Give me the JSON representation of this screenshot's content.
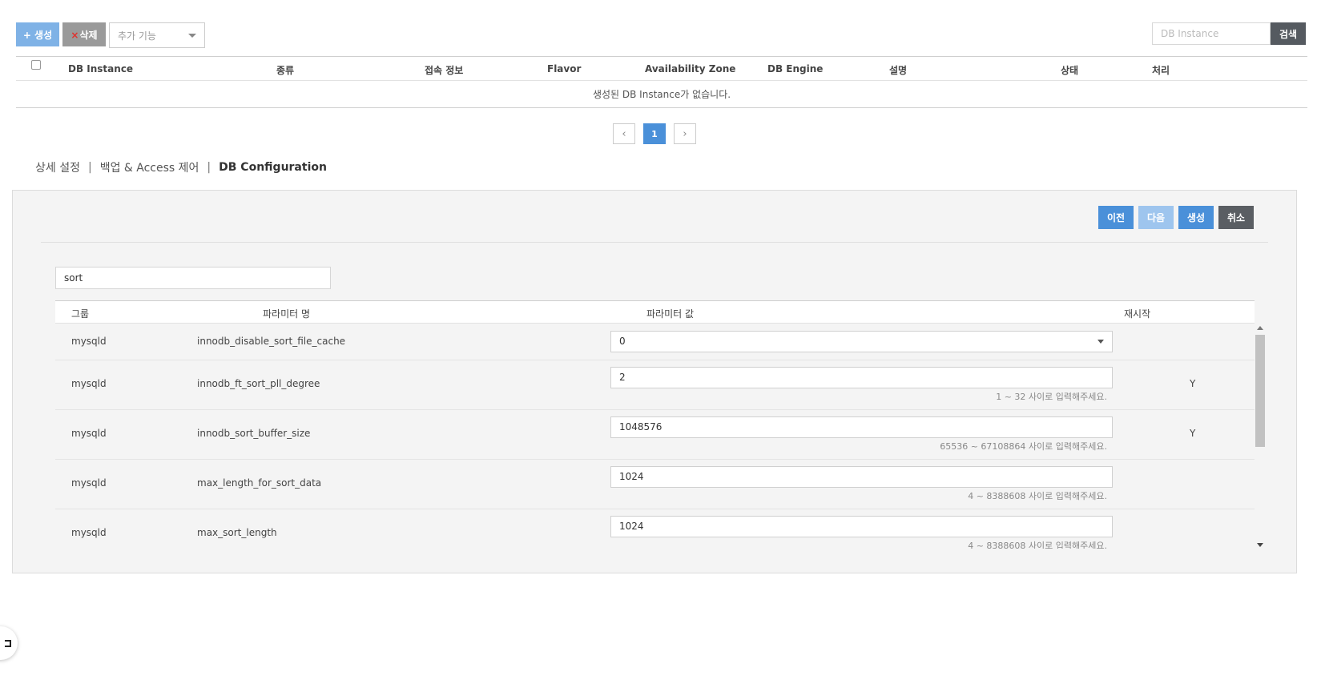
{
  "toolbar": {
    "create_label": "+ 생성",
    "delete_x": "×",
    "delete_label": "삭제",
    "extra_label": "추가 기능"
  },
  "search": {
    "placeholder": "DB Instance",
    "button_label": "검색"
  },
  "instance_table": {
    "columns": [
      "DB Instance",
      "종류",
      "접속 정보",
      "Flavor",
      "Availability Zone",
      "DB Engine",
      "설명",
      "상태",
      "처리"
    ],
    "empty_message": "생성된 DB Instance가 없습니다."
  },
  "pagination": {
    "prev": "‹",
    "current": "1",
    "next": "›"
  },
  "tabs": {
    "items": [
      "상세 설정",
      "백업 & Access 제어",
      "DB Configuration"
    ],
    "separator": "|",
    "active": "DB Configuration"
  },
  "panel": {
    "prev_label": "이전",
    "next_label": "다음",
    "create_label": "생성",
    "cancel_label": "취소",
    "filter_value": "sort"
  },
  "param_table": {
    "columns": {
      "group": "그룹",
      "name": "파라미터 명",
      "value": "파라미터 값",
      "restart": "재시작"
    },
    "rows": [
      {
        "group": "mysqld",
        "name": "innodb_disable_sort_file_cache",
        "value": "0",
        "hint": "",
        "restart": ""
      },
      {
        "group": "mysqld",
        "name": "innodb_ft_sort_pll_degree",
        "value": "2",
        "hint": "1 ~ 32 사이로 입력해주세요.",
        "restart": "Y"
      },
      {
        "group": "mysqld",
        "name": "innodb_sort_buffer_size",
        "value": "1048576",
        "hint": "65536 ~ 67108864 사이로 입력해주세요.",
        "restart": "Y"
      },
      {
        "group": "mysqld",
        "name": "max_length_for_sort_data",
        "value": "1024",
        "hint": "4 ~ 8388608 사이로 입력해주세요.",
        "restart": ""
      },
      {
        "group": "mysqld",
        "name": "max_sort_length",
        "value": "1024",
        "hint": "4 ~ 8388608 사이로 입력해주세요.",
        "restart": ""
      }
    ]
  },
  "colors": {
    "primary": "#4a90d9",
    "primary_light": "#7fb2e6",
    "disabled_blue": "#9ec5ee",
    "dark_button": "#5a5e63",
    "delete_x": "#e0312e",
    "panel_bg": "#f4f4f4"
  }
}
